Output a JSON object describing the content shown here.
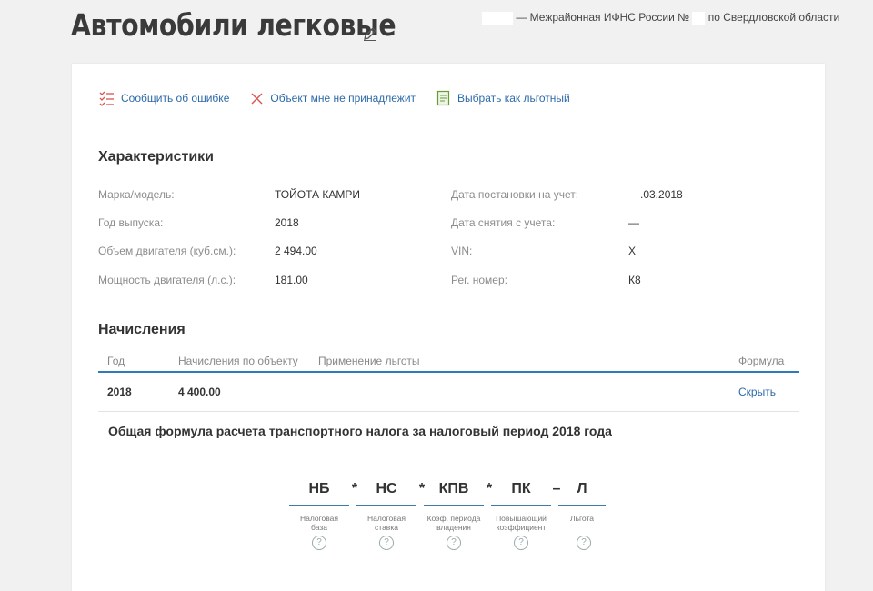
{
  "header": {
    "title": "Автомобили легковые",
    "inspection_prefix": "— Межрайонная ИФНС России №",
    "inspection_suffix": "по Свердловской области"
  },
  "actions": [
    {
      "label": "Сообщить об ошибке",
      "icon": "report-error-icon"
    },
    {
      "label": "Объект мне не принадлежит",
      "icon": "close-icon"
    },
    {
      "label": "Выбрать как льготный",
      "icon": "document-icon"
    }
  ],
  "characteristics": {
    "title": "Характеристики",
    "left": [
      {
        "label": "Марка/модель:",
        "value": "ТОЙОТА КАМРИ"
      },
      {
        "label": "Год выпуска:",
        "value": "2018"
      },
      {
        "label": "Объем двигателя (куб.см.):",
        "value": "2 494.00"
      },
      {
        "label": "Мощность двигателя (л.с.):",
        "value": "181.00"
      }
    ],
    "right": [
      {
        "label": "Дата постановки на учет:",
        "value": ".03.2018"
      },
      {
        "label": "Дата снятия с учета:",
        "value": "—"
      },
      {
        "label": "VIN:",
        "value": "Х"
      },
      {
        "label": "Рег. номер:",
        "value": "К8"
      }
    ]
  },
  "charges": {
    "title": "Начисления",
    "columns": [
      "Год",
      "Начисления по объекту",
      "Применение льготы",
      "Формула"
    ],
    "rows": [
      {
        "year": "2018",
        "amount": "4 400.00",
        "benefit": "",
        "formula_link": "Скрыть"
      }
    ]
  },
  "formula": {
    "title": "Общая формула расчета транспортного налога за налоговый период 2018 года",
    "terms": [
      {
        "symbol": "НБ",
        "caption_1": "Налоговая",
        "caption_2": "база"
      },
      {
        "symbol": "НС",
        "caption_1": "Налоговая",
        "caption_2": "ставка"
      },
      {
        "symbol": "КПВ",
        "caption_1": "Коэф. периода",
        "caption_2": "владения"
      },
      {
        "symbol": "ПК",
        "caption_1": "Повышающий",
        "caption_2": "коэффициент"
      },
      {
        "symbol": "Л",
        "caption_1": "Льгота",
        "caption_2": ""
      }
    ],
    "operators": [
      "*",
      "*",
      "*",
      "–"
    ],
    "help_symbol": "?"
  },
  "colors": {
    "accent": "#2d6aa8",
    "underline": "#2f7ab8",
    "error": "#d9534f"
  }
}
